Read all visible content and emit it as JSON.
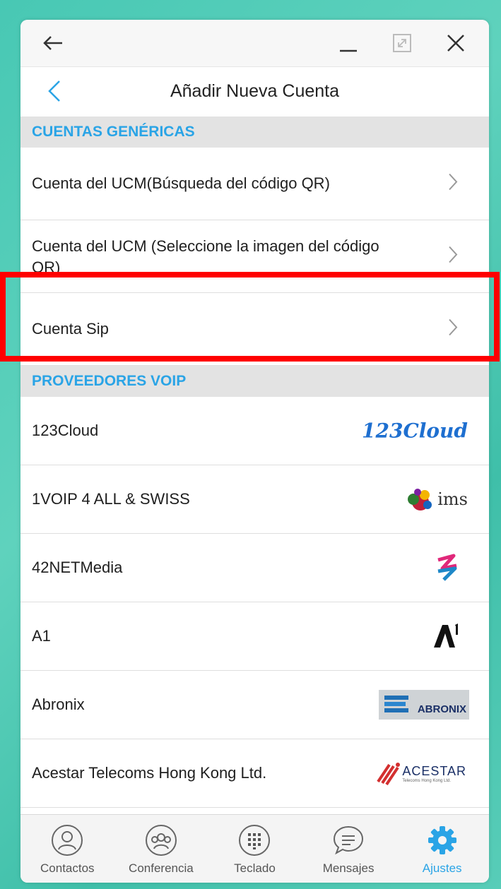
{
  "window": {
    "controls": {
      "back_icon": "arrow-left-icon",
      "minimize_icon": "minimize-icon",
      "maximize_icon": "maximize-icon",
      "close_icon": "close-icon"
    }
  },
  "header": {
    "back_icon": "chevron-left-icon",
    "title": "Añadir Nueva Cuenta"
  },
  "sections": {
    "generic_title": "CUENTAS GENÉRICAS",
    "providers_title": "PROVEEDORES VOIP"
  },
  "generic_accounts": [
    {
      "label": "Cuenta del UCM(Búsqueda del código QR)"
    },
    {
      "label": "Cuenta del UCM (Seleccione la imagen del código QR)"
    },
    {
      "label": "Cuenta Sip"
    }
  ],
  "providers": [
    {
      "label": "123Cloud",
      "logo": "123cloud-logo"
    },
    {
      "label": "1VOIP 4 ALL & SWISS",
      "logo": "ims-logo"
    },
    {
      "label": "42NETMedia",
      "logo": "42netmedia-logo"
    },
    {
      "label": "A1",
      "logo": "a1-logo"
    },
    {
      "label": "Abronix",
      "logo": "abronix-logo"
    },
    {
      "label": "Acestar Telecoms Hong Kong Ltd.",
      "logo": "acestar-logo"
    }
  ],
  "logos": {
    "cloud_text": "123Cloud",
    "ims_text": "ims",
    "abronix_text": "ABRONIX",
    "acestar_text": "ACESTAR",
    "acestar_sub": "Telecoms Hong Kong Ltd."
  },
  "tabs": [
    {
      "label": "Contactos",
      "icon": "person-icon",
      "active": false
    },
    {
      "label": "Conferencia",
      "icon": "group-icon",
      "active": false
    },
    {
      "label": "Teclado",
      "icon": "keypad-icon",
      "active": false
    },
    {
      "label": "Mensajes",
      "icon": "message-icon",
      "active": false
    },
    {
      "label": "Ajustes",
      "icon": "gear-icon",
      "active": true
    }
  ],
  "colors": {
    "accent": "#2aa4e6",
    "highlight": "#ff0000",
    "background": "#48c8b4"
  }
}
